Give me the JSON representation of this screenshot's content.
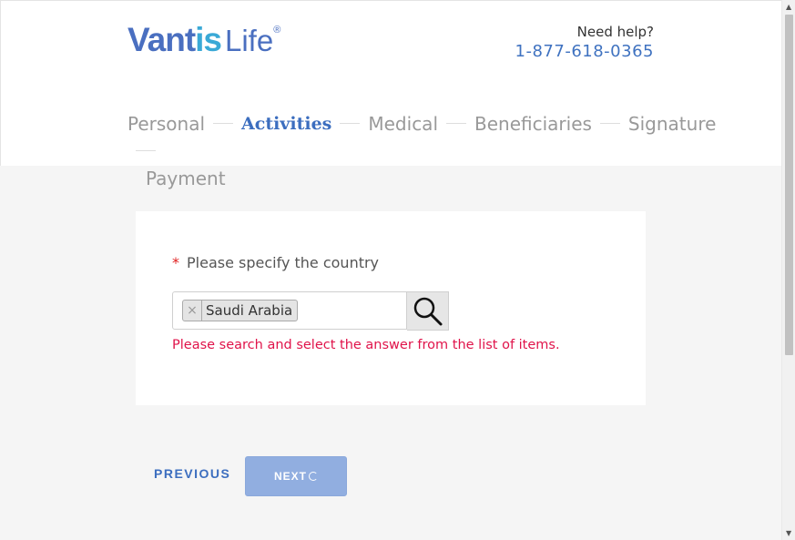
{
  "header": {
    "logo": {
      "brand_part1": "Vant",
      "brand_part2": "is",
      "brand_part3": "Life",
      "registered": "®"
    },
    "help": {
      "label": "Need help?",
      "phone": "1-877-618-0365"
    }
  },
  "steps": [
    {
      "label": "Personal",
      "active": false
    },
    {
      "label": "Activities",
      "active": true
    },
    {
      "label": "Medical",
      "active": false
    },
    {
      "label": "Beneficiaries",
      "active": false
    },
    {
      "label": "Signature",
      "active": false
    },
    {
      "label": "Payment",
      "active": false
    }
  ],
  "form": {
    "required_marker": "*",
    "question": "Please specify the country",
    "selected_tag": {
      "remove_symbol": "×",
      "value": "Saudi Arabia"
    },
    "error": "Please search and select the answer from the list of items."
  },
  "nav": {
    "previous_label": "PREVIOUS",
    "next_label": "NEXT"
  },
  "scrollbar": {
    "up_arrow": "▲",
    "down_arrow": "▼"
  },
  "colors": {
    "primary": "#3c6ebf",
    "error": "#e0134a",
    "next_button": "#91aee0",
    "background": "#f5f5f5"
  }
}
